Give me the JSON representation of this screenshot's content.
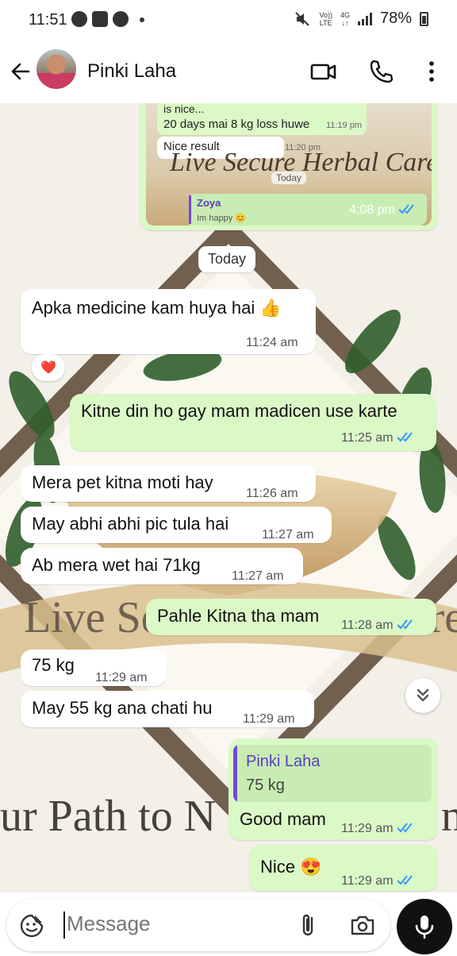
{
  "status_bar": {
    "time": "11:51",
    "network_top": "Vo))",
    "network_bottom": "LTE",
    "gen_top": "4G",
    "gen_bottom": "↓↑",
    "battery": "78%"
  },
  "header": {
    "contact_name": "Pinki Laha"
  },
  "forwarded_image": {
    "line1": "is nice...",
    "line2": "20 days mai 8 kg loss huwe",
    "line2_time": "11:19 pm",
    "line3": "Nice result",
    "line3_time": "11:20 pm",
    "banner_text": "Live Secure Herbal Care",
    "inner_chip": "Today",
    "reply_name": "Zoya",
    "reply_text": "Im happy 😊",
    "time": "4:08 pm"
  },
  "wallpaper": {
    "line1": "Live Secure Herbal Care",
    "line2": "ur Path to N",
    "line2_end": "n"
  },
  "day_chip": "Today",
  "messages": [
    {
      "text": "Apka medicine kam huya hai 👍",
      "time": "11:24 am"
    },
    {
      "text": "Kitne din ho gay mam madicen use karte",
      "time": "11:25 am"
    },
    {
      "text": "Mera pet kitna moti hay",
      "time": "11:26 am"
    },
    {
      "text": "May abhi abhi pic tula hai",
      "time": "11:27 am"
    },
    {
      "text": "Ab mera wet hai 71kg",
      "time": "11:27 am"
    },
    {
      "text": "Pahle Kitna tha mam",
      "time": "11:28 am"
    },
    {
      "text": "75 kg",
      "time": "11:29 am"
    },
    {
      "text": "May 55 kg ana chati hu",
      "time": "11:29 am"
    },
    {
      "quote_name": "Pinki Laha",
      "quote_text": "75 kg",
      "text": "Good mam",
      "time": "11:29 am"
    },
    {
      "text": "Nice 😍",
      "time": "11:29 am"
    }
  ],
  "reaction": "❤️",
  "input": {
    "placeholder": "Message"
  },
  "colors": {
    "outgoing": "#dbf8c7",
    "incoming": "#ffffff",
    "read_ticks": "#3497f9",
    "quote_bar": "#6f4ad6"
  }
}
